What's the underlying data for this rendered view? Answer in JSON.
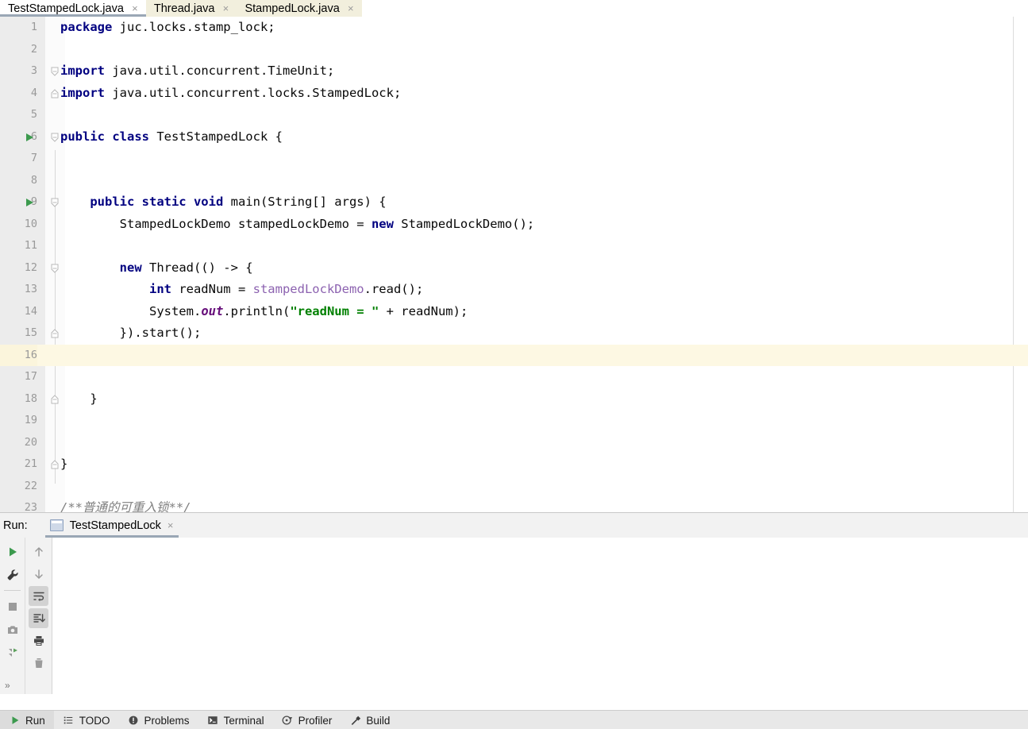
{
  "editor_tabs": [
    {
      "label": "TestStampedLock.java",
      "active": true,
      "close": "×"
    },
    {
      "label": "Thread.java",
      "active": false,
      "close": "×"
    },
    {
      "label": "StampedLock.java",
      "active": false,
      "close": "×"
    }
  ],
  "code_lines": [
    {
      "number": "1",
      "runmark": false,
      "fold": "none",
      "caret": false,
      "tokens": [
        {
          "t": "kw",
          "v": "package"
        },
        {
          "t": "plain",
          "v": " juc.locks.stamp_lock;"
        }
      ]
    },
    {
      "number": "2",
      "runmark": false,
      "fold": "none",
      "caret": false,
      "tokens": []
    },
    {
      "number": "3",
      "runmark": false,
      "fold": "start",
      "caret": false,
      "tokens": [
        {
          "t": "kw",
          "v": "import"
        },
        {
          "t": "plain",
          "v": " java.util.concurrent.TimeUnit;"
        }
      ]
    },
    {
      "number": "4",
      "runmark": false,
      "fold": "end",
      "caret": false,
      "tokens": [
        {
          "t": "kw",
          "v": "import"
        },
        {
          "t": "plain",
          "v": " java.util.concurrent.locks.StampedLock;"
        }
      ]
    },
    {
      "number": "5",
      "runmark": false,
      "fold": "none",
      "caret": false,
      "tokens": []
    },
    {
      "number": "6",
      "runmark": true,
      "fold": "start",
      "caret": false,
      "tokens": [
        {
          "t": "kw",
          "v": "public class"
        },
        {
          "t": "plain",
          "v": " TestStampedLock {"
        }
      ]
    },
    {
      "number": "7",
      "runmark": false,
      "fold": "none",
      "caret": false,
      "tokens": []
    },
    {
      "number": "8",
      "runmark": false,
      "fold": "none",
      "caret": false,
      "tokens": []
    },
    {
      "number": "9",
      "runmark": true,
      "fold": "start",
      "caret": false,
      "tokens": [
        {
          "t": "plain",
          "v": "    "
        },
        {
          "t": "kw",
          "v": "public static void"
        },
        {
          "t": "plain",
          "v": " main(String[] args) {"
        }
      ]
    },
    {
      "number": "10",
      "runmark": false,
      "fold": "none",
      "caret": false,
      "tokens": [
        {
          "t": "plain",
          "v": "        StampedLockDemo stampedLockDemo = "
        },
        {
          "t": "kw",
          "v": "new"
        },
        {
          "t": "plain",
          "v": " StampedLockDemo();"
        }
      ]
    },
    {
      "number": "11",
      "runmark": false,
      "fold": "none",
      "caret": false,
      "tokens": []
    },
    {
      "number": "12",
      "runmark": false,
      "fold": "start",
      "caret": false,
      "tokens": [
        {
          "t": "plain",
          "v": "        "
        },
        {
          "t": "kw",
          "v": "new"
        },
        {
          "t": "plain",
          "v": " Thread(() -> {"
        }
      ]
    },
    {
      "number": "13",
      "runmark": false,
      "fold": "none",
      "caret": false,
      "tokens": [
        {
          "t": "plain",
          "v": "            "
        },
        {
          "t": "kw",
          "v": "int"
        },
        {
          "t": "plain",
          "v": " readNum = "
        },
        {
          "t": "lvar",
          "v": "stampedLockDemo"
        },
        {
          "t": "plain",
          "v": ".read();"
        }
      ]
    },
    {
      "number": "14",
      "runmark": false,
      "fold": "none",
      "caret": false,
      "tokens": [
        {
          "t": "plain",
          "v": "            System."
        },
        {
          "t": "field",
          "v": "out"
        },
        {
          "t": "plain",
          "v": ".println("
        },
        {
          "t": "str",
          "v": "\"readNum = \""
        },
        {
          "t": "plain",
          "v": " + readNum);"
        }
      ]
    },
    {
      "number": "15",
      "runmark": false,
      "fold": "end",
      "caret": false,
      "tokens": [
        {
          "t": "plain",
          "v": "        }).start();"
        }
      ]
    },
    {
      "number": "16",
      "runmark": false,
      "fold": "none",
      "caret": true,
      "tokens": []
    },
    {
      "number": "17",
      "runmark": false,
      "fold": "none",
      "caret": false,
      "tokens": []
    },
    {
      "number": "18",
      "runmark": false,
      "fold": "end",
      "caret": false,
      "tokens": [
        {
          "t": "plain",
          "v": "    }"
        }
      ]
    },
    {
      "number": "19",
      "runmark": false,
      "fold": "none",
      "caret": false,
      "tokens": []
    },
    {
      "number": "20",
      "runmark": false,
      "fold": "none",
      "caret": false,
      "tokens": []
    },
    {
      "number": "21",
      "runmark": false,
      "fold": "end",
      "caret": false,
      "tokens": [
        {
          "t": "plain",
          "v": "}"
        }
      ]
    },
    {
      "number": "22",
      "runmark": false,
      "fold": "none",
      "caret": false,
      "tokens": []
    },
    {
      "number": "23",
      "runmark": false,
      "fold": "none",
      "caret": false,
      "tokens": [
        {
          "t": "cmt",
          "v": "/**普通的可重入锁**/"
        }
      ]
    }
  ],
  "run_window": {
    "header_label": "Run:",
    "tab": {
      "label": "TestStampedLock",
      "close": "×",
      "icon": "console-icon"
    },
    "toolbar_left": [
      {
        "name": "rerun-button",
        "icon": "play-icon",
        "selected": false
      },
      {
        "name": "edit-configurations",
        "icon": "wrench-icon",
        "selected": false
      },
      {
        "name": "stop-button",
        "icon": "stop-icon",
        "selected": false
      },
      {
        "name": "screenshot-button",
        "icon": "camera-icon",
        "selected": false
      },
      {
        "name": "rerun-failed-tests",
        "icon": "rerun-tests-icon",
        "selected": false
      }
    ],
    "toolbar_right": [
      {
        "name": "up-the-stack-trace",
        "icon": "arrow-up-icon",
        "selected": false
      },
      {
        "name": "down-the-stack-trace",
        "icon": "arrow-down-icon",
        "selected": false
      },
      {
        "name": "soft-wrap-toggle",
        "icon": "soft-wrap-icon",
        "selected": true
      },
      {
        "name": "scroll-to-end",
        "icon": "scroll-to-end-icon",
        "selected": true
      },
      {
        "name": "print-button",
        "icon": "printer-icon",
        "selected": false
      },
      {
        "name": "clear-all-button",
        "icon": "trash-icon",
        "selected": false
      }
    ],
    "overflow_label": "»",
    "console_output": ""
  },
  "status_bar": [
    {
      "label": "Run",
      "icon": "play-icon",
      "active": true
    },
    {
      "label": "TODO",
      "icon": "list-icon",
      "active": false
    },
    {
      "label": "Problems",
      "icon": "warning-icon",
      "active": false
    },
    {
      "label": "Terminal",
      "icon": "terminal-icon",
      "active": false
    },
    {
      "label": "Profiler",
      "icon": "profiler-icon",
      "active": false
    },
    {
      "label": "Build",
      "icon": "hammer-icon",
      "active": false
    }
  ],
  "colors": {
    "keyword": "#000080",
    "string": "#008000",
    "field": "#660e7a",
    "local_var": "#8c62b0",
    "comment": "#808080",
    "caret_line": "#fdf8e3",
    "tab_inactive": "#f2efdd",
    "tab_underline": "#9aa7b5",
    "run_marker": "#3c9a4e"
  }
}
